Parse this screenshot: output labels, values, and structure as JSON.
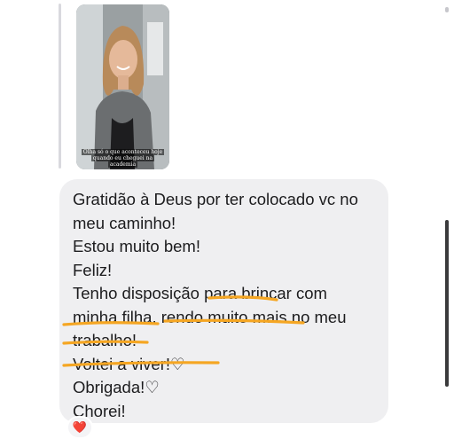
{
  "story_reply": {
    "caption_lines": [
      "Olha só o que aconteceu hoje",
      "quando eu cheguei na",
      "academia"
    ]
  },
  "message": {
    "lines": [
      "Gratidão à Deus por ter colocado vc no",
      "meu caminho!",
      "Estou muito bem!",
      "Feliz!",
      "Tenho disposição para brincar com",
      "minha filha, rendo muito mais no meu",
      "trabalho!",
      "Voltei a viver!♡",
      "Obrigada!♡",
      "Chorei!"
    ]
  },
  "reaction": {
    "emoji": "❤️",
    "icon": "heart-icon"
  },
  "colors": {
    "bubble": "#efeff1",
    "highlight": "#f5a623",
    "text": "#1c1c1e"
  }
}
